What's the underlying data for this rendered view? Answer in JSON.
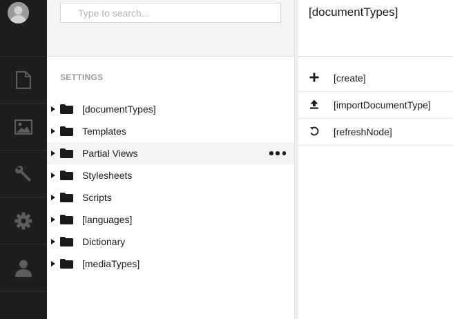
{
  "sidebar": {
    "sections": [
      {
        "name": "content",
        "icon": "document-icon"
      },
      {
        "name": "media",
        "icon": "image-icon"
      },
      {
        "name": "developer",
        "icon": "wrench-icon"
      },
      {
        "name": "settings",
        "icon": "gear-icon"
      },
      {
        "name": "users",
        "icon": "user-icon"
      }
    ]
  },
  "search": {
    "placeholder": "Type to search..."
  },
  "tree": {
    "section_title": "SETTINGS",
    "items": [
      {
        "label": "[documentTypes]"
      },
      {
        "label": "Templates"
      },
      {
        "label": "Partial Views"
      },
      {
        "label": "Stylesheets"
      },
      {
        "label": "Scripts"
      },
      {
        "label": "[languages]"
      },
      {
        "label": "Dictionary"
      },
      {
        "label": "[mediaTypes]"
      }
    ],
    "active_index": 2
  },
  "action_panel": {
    "title": "[documentTypes]",
    "actions": [
      {
        "label": "[create]",
        "icon": "plus-icon"
      },
      {
        "label": "[importDocumentType]",
        "icon": "upload-icon"
      },
      {
        "label": "[refreshNode]",
        "icon": "refresh-icon"
      }
    ]
  },
  "colors": {
    "rail_background": "#1d1d1d",
    "rail_icon": "#5d5d5d",
    "header_background": "#f4f4f4",
    "active_row": "#f4f4f4",
    "text": "#1b1b1b",
    "section_title": "#9b9b9b"
  }
}
